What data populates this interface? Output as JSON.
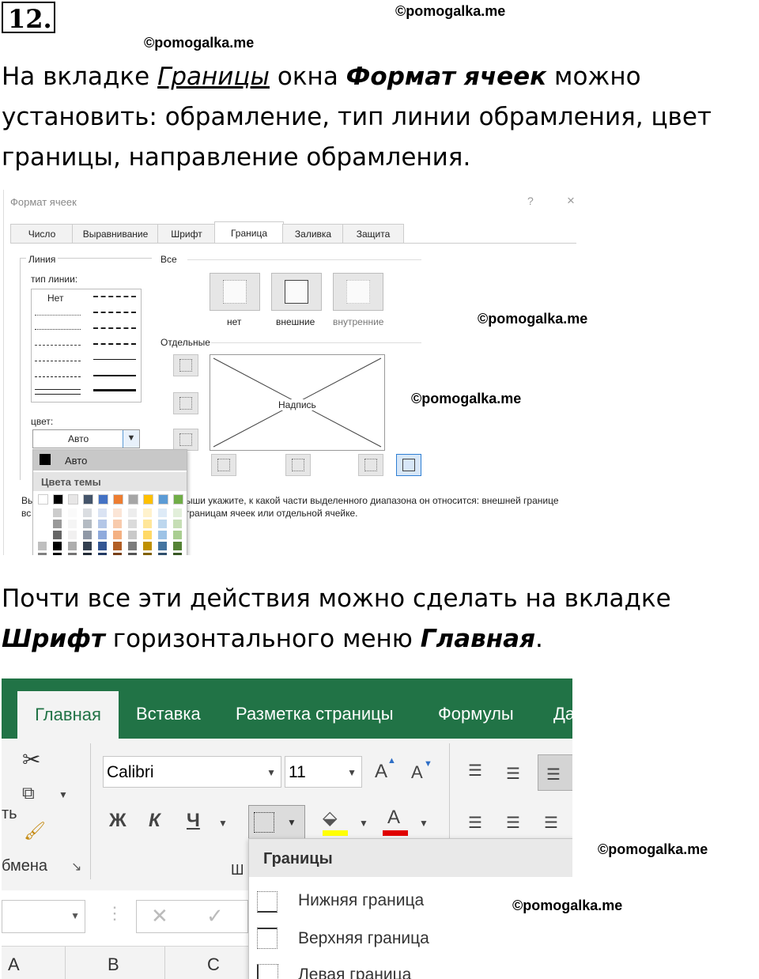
{
  "task_number": "12.",
  "watermark": "©pomogalka.me",
  "paragraph1": {
    "p1": "На вкладке ",
    "tab_name": "Границы",
    "p2": " окна ",
    "window_name": "Формат ячеек",
    "p3": " можно установить: обрамление, тип линии обрамления, цвет границы, направление обрамления."
  },
  "paragraph2": {
    "p1": "Почти все эти действия можно сделать на вкладке ",
    "tab_name": "Шрифт",
    "p2": " горизонтального меню ",
    "menu_name": "Главная",
    "p3": "."
  },
  "dialog": {
    "title": "Формат ячеек",
    "help": "?",
    "close": "×",
    "tabs": [
      "Число",
      "Выравнивание",
      "Шрифт",
      "Граница",
      "Заливка",
      "Защита"
    ],
    "active_tab": "Граница",
    "line_group": "Линия",
    "line_type_label": "тип линии:",
    "line_none": "Нет",
    "color_label": "цвет:",
    "color_value": "Авто",
    "all_label": "Все",
    "presets": [
      "нет",
      "внешние",
      "внутренние"
    ],
    "separate_label": "Отдельные",
    "preview_text": "Надпись",
    "hint_left_1": "Вы",
    "hint_left_2": "вс",
    "hint_right_1": "ыши укажите, к какой части выделенного диапазона он относится: внешней границе",
    "hint_right_2": "границам ячеек или отдельной ячейке.",
    "palette_auto": "Авто",
    "palette_theme": "Цвета темы",
    "theme_colors": [
      "#ffffff",
      "#000000",
      "#e7e6e6",
      "#44546a",
      "#4472c4",
      "#ed7d31",
      "#a5a5a5",
      "#ffc000",
      "#5b9bd5",
      "#70ad47"
    ]
  },
  "ribbon": {
    "tabs": [
      "Главная",
      "Вставка",
      "Разметка страницы",
      "Формулы",
      "Да"
    ],
    "active_tab": "Главная",
    "font_name": "Calibri",
    "font_size": "11",
    "bold": "Ж",
    "italic": "К",
    "underline": "Ч",
    "grow": "A",
    "shrink": "A",
    "clip_tail": "ть",
    "clipboard_tail": "бмена",
    "font_group_tail": "Ш",
    "cols": [
      "A",
      "B",
      "C"
    ],
    "menu_title": "Границы",
    "menu_items": [
      "Нижняя граница",
      "Верхняя граница",
      "Левая граница"
    ]
  },
  "colors": {
    "excel_green": "#217346"
  }
}
